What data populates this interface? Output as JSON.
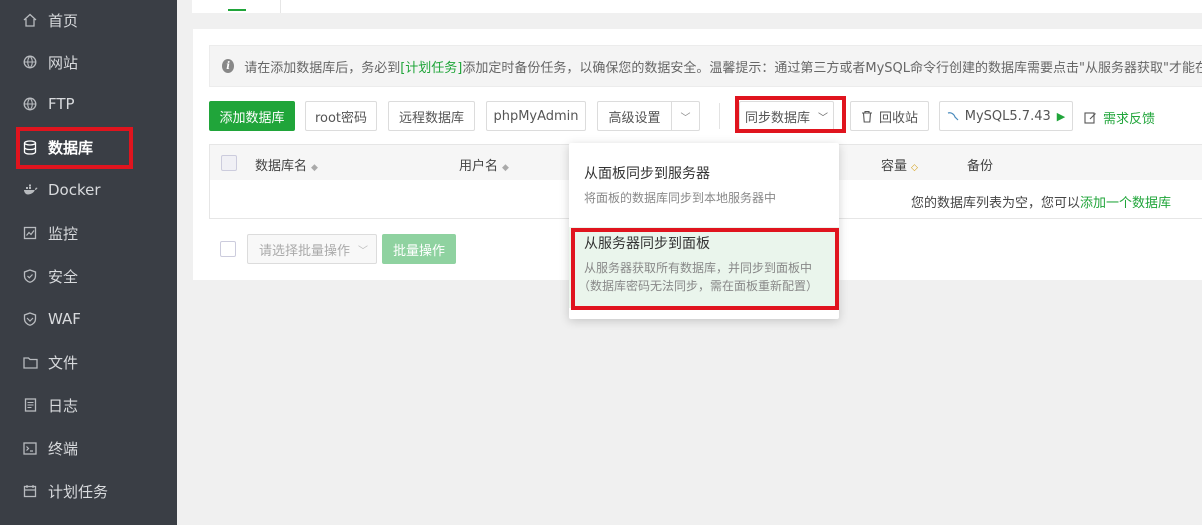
{
  "sidebar": {
    "items": [
      {
        "label": "首页",
        "icon": "home-icon"
      },
      {
        "label": "网站",
        "icon": "globe-icon"
      },
      {
        "label": "FTP",
        "icon": "globe-icon"
      },
      {
        "label": "数据库",
        "icon": "database-icon",
        "active": true
      },
      {
        "label": "Docker",
        "icon": "docker-icon"
      },
      {
        "label": "监控",
        "icon": "monitor-icon"
      },
      {
        "label": "安全",
        "icon": "shield-icon"
      },
      {
        "label": "WAF",
        "icon": "waf-shield-icon"
      },
      {
        "label": "文件",
        "icon": "folder-icon"
      },
      {
        "label": "日志",
        "icon": "log-icon"
      },
      {
        "label": "终端",
        "icon": "terminal-icon"
      },
      {
        "label": "计划任务",
        "icon": "calendar-icon"
      }
    ]
  },
  "notice": {
    "prefix": "请在添加数据库后，务必到",
    "link": "[计划任务]",
    "suffix": "添加定时备份任务，以确保您的数据安全。温馨提示：通过第三方或者MySQL命令行创建的数据库需要点击\"从服务器获取\"才能在"
  },
  "toolbar": {
    "add_db": "添加数据库",
    "root_pwd": "root密码",
    "remote_db": "远程数据库",
    "phpmyadmin": "phpMyAdmin",
    "advanced": "高级设置",
    "sync_db": "同步数据库",
    "recycle": "回收站",
    "mysql_version": "MySQL5.7.43",
    "feedback": "需求反馈"
  },
  "table": {
    "headers": {
      "db_name": "数据库名",
      "username": "用户名",
      "capacity": "容量",
      "backup": "备份"
    },
    "empty_prefix": "您的数据库列表为空，您可以",
    "empty_link": "添加一个数据库"
  },
  "batch": {
    "placeholder": "请选择批量操作",
    "button": "批量操作"
  },
  "sync_menu": {
    "items": [
      {
        "title": "从面板同步到服务器",
        "desc": "将面板的数据库同步到本地服务器中"
      },
      {
        "title": "从服务器同步到面板",
        "desc": "从服务器获取所有数据库，并同步到面板中",
        "desc2": "（数据库密码无法同步，需在面板重新配置）"
      }
    ]
  },
  "colors": {
    "accent": "#20a53a",
    "sidebar_bg": "#3a3e45",
    "highlight": "#e0141e"
  }
}
